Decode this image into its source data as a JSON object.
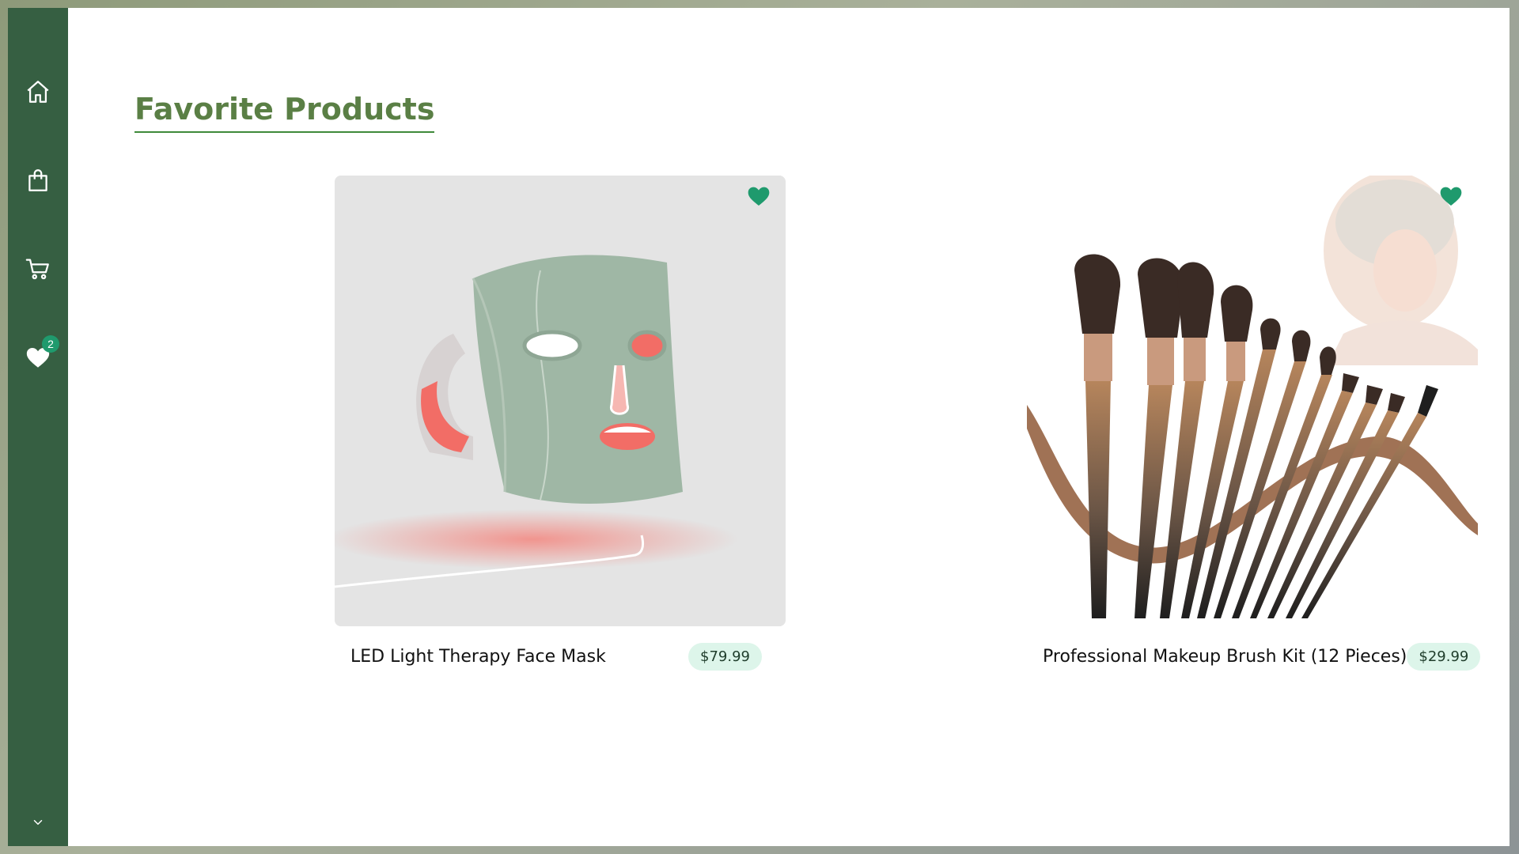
{
  "sidebar": {
    "items": [
      {
        "name": "home",
        "icon": "home-icon"
      },
      {
        "name": "shop",
        "icon": "shopping-bag-icon"
      },
      {
        "name": "cart",
        "icon": "cart-icon"
      },
      {
        "name": "favorites",
        "icon": "heart-icon",
        "badge": "2"
      }
    ],
    "footer_icon": "chevron-down-icon"
  },
  "page": {
    "title": "Favorite Products"
  },
  "products": [
    {
      "name": "LED Light Therapy Face Mask",
      "price": "$79.99",
      "image_icon": "face-mask-image",
      "favorited": true
    },
    {
      "name": "Professional Makeup Brush Kit (12 Pieces)",
      "price": "$29.99",
      "image_icon": "makeup-brushes-image",
      "favorited": true
    }
  ],
  "colors": {
    "sidebar": "#365f42",
    "accent": "#1f9a6d",
    "title": "#5a7f45",
    "price_bg": "#ddf5ea"
  }
}
